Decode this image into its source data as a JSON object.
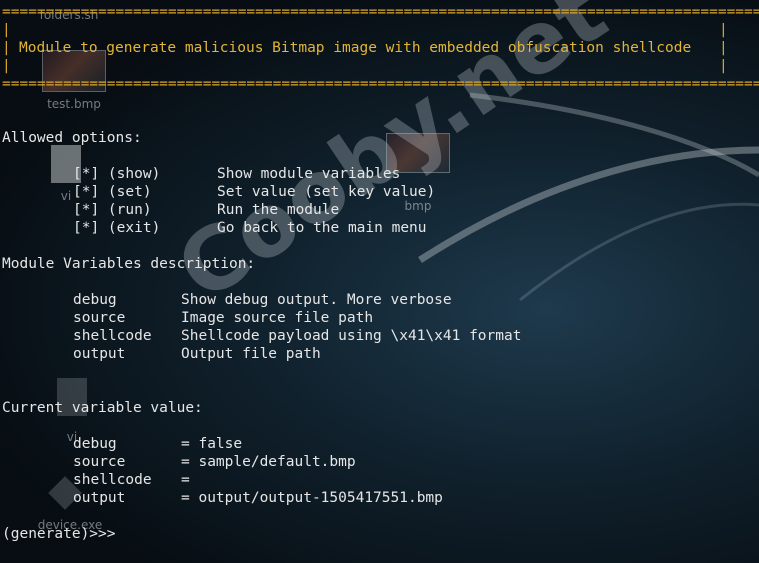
{
  "desktop": {
    "icons": [
      {
        "name": "folders-sh",
        "label": "folders.sh"
      },
      {
        "name": "test-bmp",
        "label": "test.bmp"
      },
      {
        "name": "vi-file-1",
        "label": "vi"
      },
      {
        "name": "image-thumb-2",
        "label": "bmp"
      },
      {
        "name": "vi-file-2",
        "label": "vi"
      },
      {
        "name": "device-exe",
        "label": "device.exe"
      }
    ],
    "watermark": "Cooby.net"
  },
  "terminal": {
    "banner_rule": "==========================================================================================",
    "banner_side_left": "|",
    "banner_side_right": "|",
    "banner_title": "Module to generate malicious Bitmap image with embedded obfuscation shellcode",
    "allowed_options_heading": "Allowed options:",
    "options": [
      {
        "cmd": "[*] (show)",
        "desc": "Show module variables"
      },
      {
        "cmd": "[*] (set)",
        "desc": "Set value (set key value)"
      },
      {
        "cmd": "[*] (run)",
        "desc": "Run the module"
      },
      {
        "cmd": "[*] (exit)",
        "desc": "Go back to the main menu"
      }
    ],
    "variables_heading": "Module Variables description:",
    "variables": [
      {
        "key": "debug",
        "desc": "Show debug output. More verbose"
      },
      {
        "key": "source",
        "desc": "Image source file path"
      },
      {
        "key": "shellcode",
        "desc": "Shellcode payload using \\x41\\x41 format"
      },
      {
        "key": "output",
        "desc": "Output file path"
      }
    ],
    "current_heading": "Current variable value:",
    "current": [
      {
        "key": "debug",
        "value": "= false"
      },
      {
        "key": "source",
        "value": "= sample/default.bmp"
      },
      {
        "key": "shellcode",
        "value": "="
      },
      {
        "key": "output",
        "value": "= output/output-1505417551.bmp"
      }
    ],
    "prompt": "(generate)>>>"
  }
}
